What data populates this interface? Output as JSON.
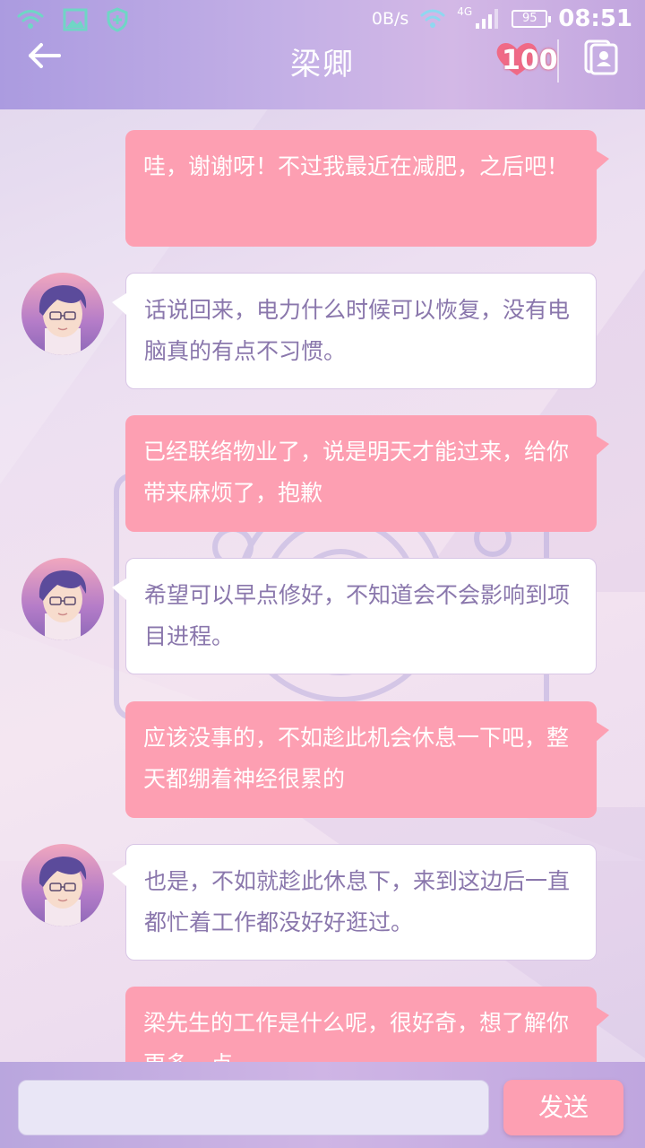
{
  "status_bar": {
    "net_speed": "0B/s",
    "network_type": "4G",
    "battery": "95",
    "time": "08:51",
    "icons": [
      "wifi-icon",
      "image-icon",
      "shield-icon"
    ]
  },
  "header": {
    "title": "梁卿",
    "favor_value": "100",
    "accent_color": "#fd9fb2"
  },
  "messages": [
    {
      "from": "me",
      "text": "哇，谢谢呀！不过我最近在减肥，之后吧！"
    },
    {
      "from": "them",
      "text": "话说回来，电力什么时候可以恢复，没有电脑真的有点不习惯。"
    },
    {
      "from": "me",
      "text": "已经联络物业了，说是明天才能过来，给你带来麻烦了，抱歉"
    },
    {
      "from": "them",
      "text": "希望可以早点修好，不知道会不会影响到项目进程。"
    },
    {
      "from": "me",
      "text": "应该没事的，不如趁此机会休息一下吧，整天都绷着神经很累的"
    },
    {
      "from": "them",
      "text": "也是，不如就趁此休息下，来到这边后一直都忙着工作都没好好逛过。"
    },
    {
      "from": "me",
      "text": "梁先生的工作是什么呢，很好奇，想了解你更多一点"
    }
  ],
  "input": {
    "value": "",
    "placeholder": "",
    "send_label": "发送"
  }
}
